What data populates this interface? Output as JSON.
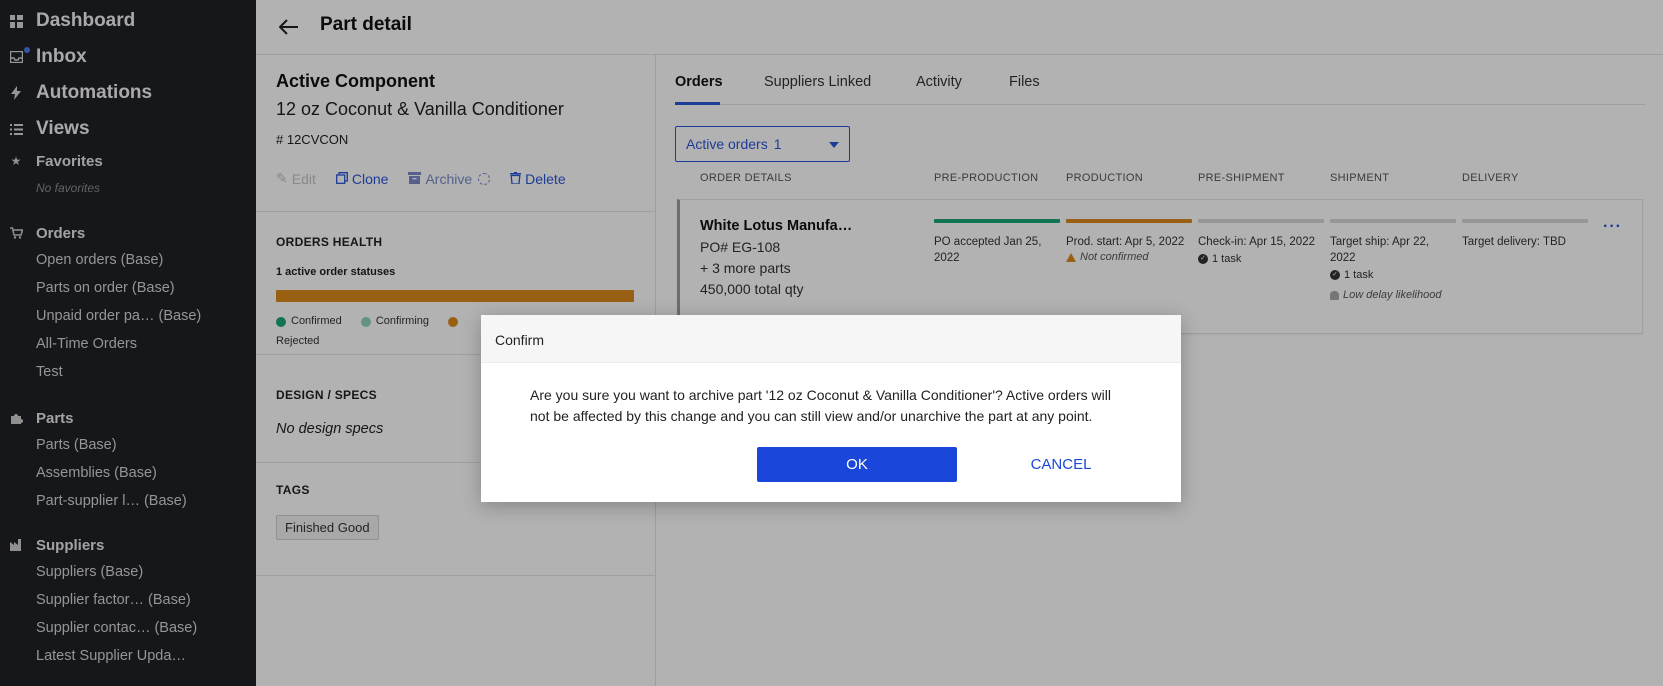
{
  "sidebar": {
    "top_items": [
      {
        "label": "Dashboard",
        "icon": "grid-icon"
      },
      {
        "label": "Inbox",
        "icon": "inbox-icon"
      },
      {
        "label": "Automations",
        "icon": "bolt-icon"
      },
      {
        "label": "Views",
        "icon": "list-icon"
      }
    ],
    "favorites": {
      "label": "Favorites",
      "empty": "No favorites"
    },
    "orders": {
      "label": "Orders",
      "items": [
        "Open orders (Base)",
        "Parts on order (Base)",
        "Unpaid order pa… (Base)",
        "All-Time Orders",
        "Test"
      ]
    },
    "parts": {
      "label": "Parts",
      "items": [
        "Parts (Base)",
        "Assemblies (Base)",
        "Part-supplier l… (Base)"
      ]
    },
    "suppliers": {
      "label": "Suppliers",
      "items": [
        "Suppliers (Base)",
        "Supplier factor… (Base)",
        "Supplier contac… (Base)",
        "Latest Supplier Upda…"
      ]
    }
  },
  "header": {
    "title": "Part detail"
  },
  "part": {
    "status": "Active Component",
    "name": "12 oz Coconut & Vanilla Conditioner",
    "sku": "# 12CVCON",
    "actions": {
      "edit": "Edit",
      "clone": "Clone",
      "archive": "Archive",
      "delete": "Delete"
    }
  },
  "orders_health": {
    "title": "ORDERS HEALTH",
    "count_label": "1 active order statuses",
    "bar_color": "#dc8a1c",
    "legend": [
      {
        "label": "Confirmed",
        "color": "#1aa57a"
      },
      {
        "label": "Confirming",
        "color": "#8fd3b8"
      },
      {
        "label": "",
        "color": "#dc8a1c"
      },
      {
        "label": "",
        "color": "#e03a3a"
      }
    ],
    "legend_tail": "Rejected"
  },
  "design_specs": {
    "title": "DESIGN / SPECS",
    "empty": "No design specs"
  },
  "tags": {
    "title": "TAGS",
    "items": [
      "Finished Good"
    ]
  },
  "tabs": [
    "Orders",
    "Suppliers Linked",
    "Activity",
    "Files"
  ],
  "filter": {
    "label": "Active orders",
    "count": "1"
  },
  "columns": [
    "ORDER DETAILS",
    "PRE-PRODUCTION",
    "PRODUCTION",
    "PRE-SHIPMENT",
    "SHIPMENT",
    "DELIVERY"
  ],
  "order": {
    "supplier": "White Lotus Manufa…",
    "po": "PO# EG-108",
    "more_parts": "+ 3 more parts",
    "qty": "450,000 total qty",
    "pre_production": {
      "text": "PO accepted Jan 25, 2022",
      "color": "#1aa57a"
    },
    "production": {
      "text": "Prod. start: Apr 5, 2022",
      "sub": "Not confirmed",
      "color": "#dc8a1c"
    },
    "pre_shipment": {
      "text": "Check-in: Apr 15, 2022",
      "task": "1 task",
      "color": "#d9d9d9"
    },
    "shipment": {
      "text": "Target ship: Apr 22, 2022",
      "task": "1 task",
      "sub": "Low delay likelihood",
      "color": "#d9d9d9"
    },
    "delivery": {
      "text": "Target delivery: TBD",
      "color": "#d9d9d9"
    },
    "more": "···"
  },
  "modal": {
    "title": "Confirm",
    "body": "Are you sure you want to archive part '12 oz Coconut & Vanilla Conditioner'? Active orders will not be affected by this change and you can still view and/or unarchive the part at any point.",
    "ok": "OK",
    "cancel": "CANCEL"
  }
}
